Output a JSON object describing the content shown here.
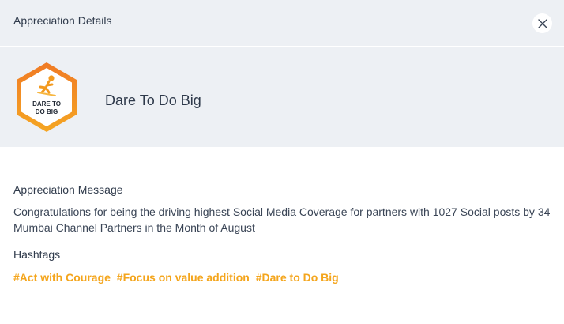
{
  "header": {
    "title": "Appreciation Details",
    "close_icon": "close-icon"
  },
  "badge": {
    "icon": "person-jumping-icon",
    "text_line1": "DARE TO",
    "text_line2": "DO BIG",
    "name": "Dare To Do Big",
    "colors": {
      "top": "#f07a24",
      "bottom": "#f5a623"
    }
  },
  "appreciation": {
    "message_label": "Appreciation Message",
    "message": "Congratulations for being the driving highest Social Media Coverage for partners with 1027 Social posts by 34 Mumbai Channel Partners in the Month of August",
    "hashtags_label": "Hashtags",
    "hashtags": [
      "#Act with Courage",
      "#Focus on value addition",
      "#Dare to Do Big"
    ]
  },
  "colors": {
    "hashtag": "#f4a51c",
    "band_bg": "#edf0f4"
  }
}
